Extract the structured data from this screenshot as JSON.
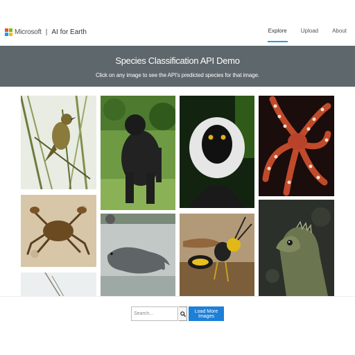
{
  "header": {
    "brand": "Microsoft",
    "separator": "|",
    "product": "AI for Earth",
    "nav": [
      {
        "label": "Explore",
        "active": true
      },
      {
        "label": "Upload",
        "active": false
      },
      {
        "label": "About",
        "active": false
      }
    ],
    "logo_colors": [
      "#f25022",
      "#7fba00",
      "#00a4ef",
      "#ffb900"
    ]
  },
  "banner": {
    "title": "Species Classification API Demo",
    "subtitle": "Click on any image to see the API's predicted species for that image."
  },
  "gallery": {
    "images": [
      {
        "subject": "songbird"
      },
      {
        "subject": "gorilla"
      },
      {
        "subject": "lemur"
      },
      {
        "subject": "octopus"
      },
      {
        "subject": "crab"
      },
      {
        "subject": "seal"
      },
      {
        "subject": "wasp"
      },
      {
        "subject": "tuatara"
      },
      {
        "subject": "bird"
      }
    ]
  },
  "search": {
    "placeholder": "Search...",
    "button_icon": "search-icon"
  },
  "load_more": {
    "label": "Load More Images"
  },
  "colors": {
    "banner_bg": "#5e676b",
    "accent": "#2b9fd8",
    "button_bg": "#1e7fd6"
  }
}
